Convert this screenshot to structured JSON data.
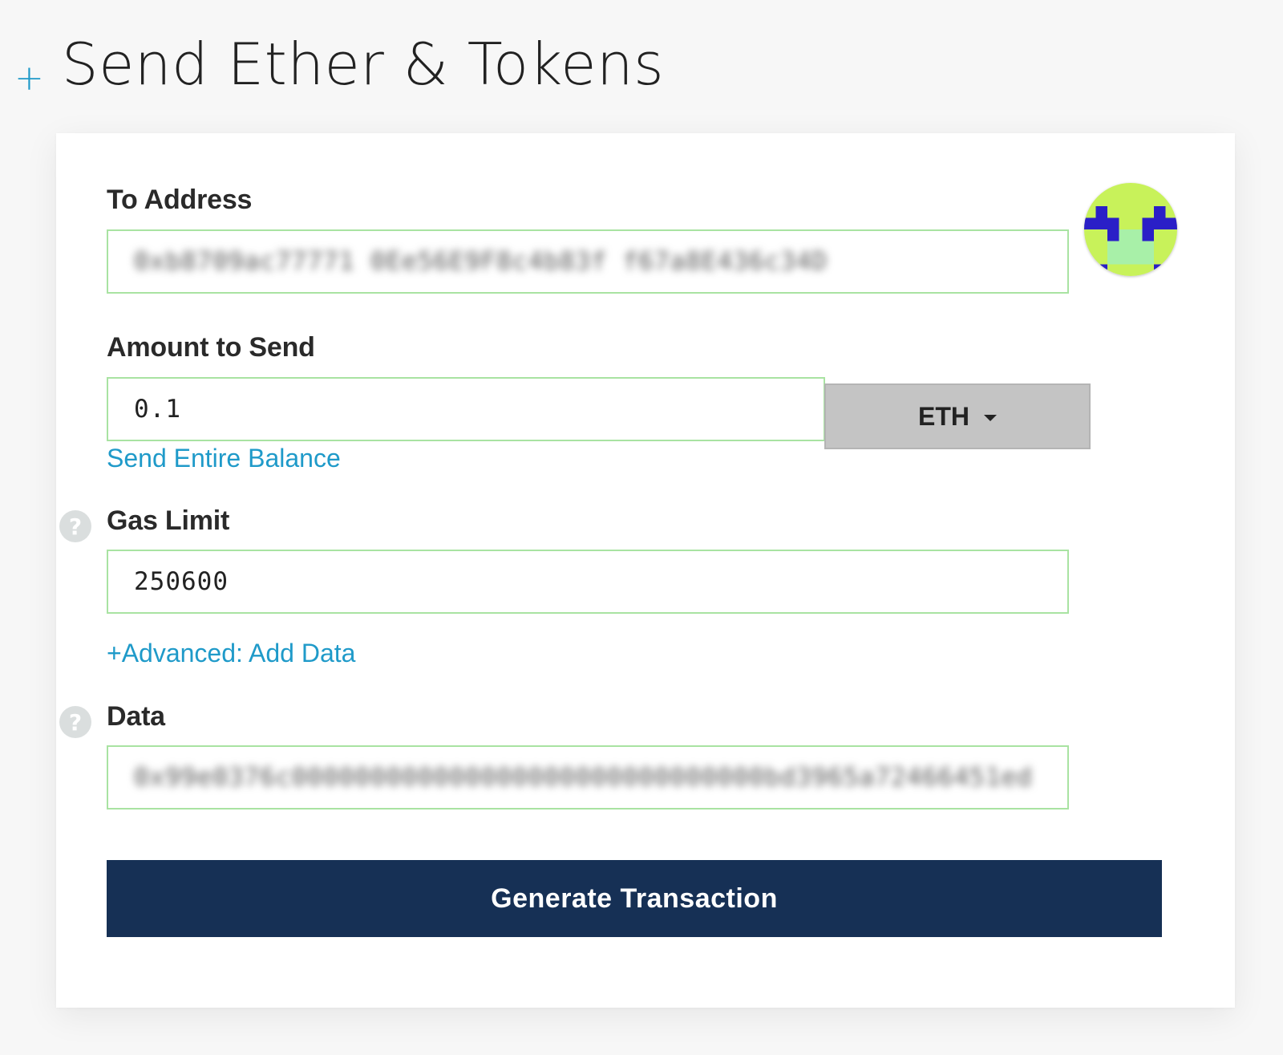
{
  "header": {
    "toggle_icon": "plus-icon",
    "toggle_symbol": "+",
    "title": "Send Ether & Tokens"
  },
  "form": {
    "to_address": {
      "label": "To Address",
      "value": "0xb8709ac77771 0Ee56E9F8c4b83f f67a8E436c34D",
      "identicon": "identicon-avatar"
    },
    "amount": {
      "label": "Amount to Send",
      "value": "0.1",
      "unit": "ETH",
      "send_entire_balance": "Send Entire Balance"
    },
    "gas_limit": {
      "label": "Gas Limit",
      "value": "250600",
      "help_icon": "question-icon"
    },
    "advanced_link": "+Advanced: Add Data",
    "data": {
      "label": "Data",
      "value": "0x99e0376c000000000000000000000000000000bd3965a72466451ed",
      "help_icon": "question-icon"
    },
    "generate_button": "Generate Transaction"
  },
  "colors": {
    "accent": "#1f9ac9",
    "input_border_valid": "#a9e3a2",
    "button_bg": "#163055",
    "dropdown_bg": "#c4c4c4",
    "identicon_bg": "#c8f25a",
    "identicon_fg": "#2a1fc7",
    "identicon_accent": "#a8f0a8"
  }
}
